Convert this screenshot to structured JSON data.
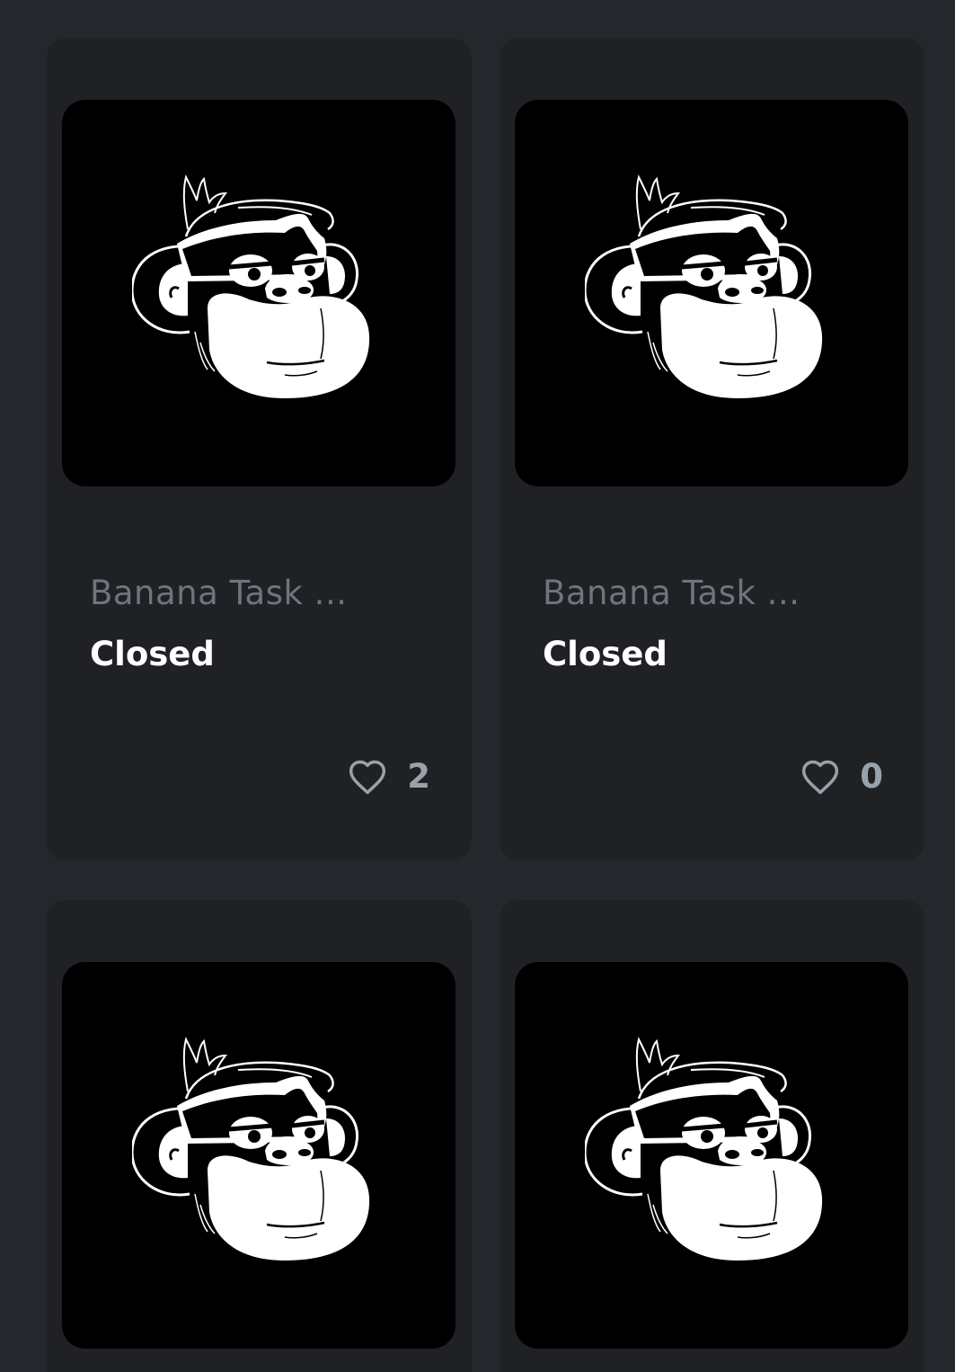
{
  "cards": [
    {
      "title": "Banana Task ...",
      "status": "Closed",
      "likes": "2",
      "image_icon": "ape-head-icon",
      "like_icon": "heart-icon"
    },
    {
      "title": "Banana Task ...",
      "status": "Closed",
      "likes": "0",
      "image_icon": "ape-head-icon",
      "like_icon": "heart-icon"
    },
    {
      "title": "",
      "status": "",
      "likes": "",
      "image_icon": "ape-head-icon"
    },
    {
      "title": "",
      "status": "",
      "likes": "",
      "image_icon": "ape-head-icon"
    }
  ],
  "colors": {
    "page_bg": "#24282c",
    "card_bg": "#1f2125",
    "title": "#6d757e",
    "status": "#ffffff",
    "likes": "#99a1aa"
  }
}
